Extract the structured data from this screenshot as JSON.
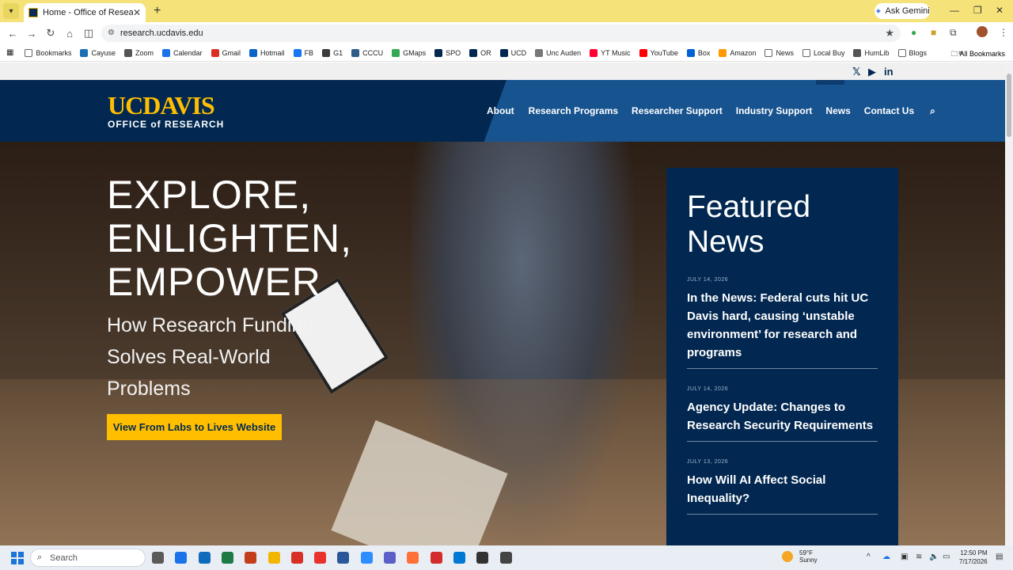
{
  "browser": {
    "tab_title": "Home - Office of Research",
    "new_tab": "+",
    "ask_gemini": "Ask Gemini",
    "url": "research.ucdavis.edu",
    "all_bookmarks": "All Bookmarks",
    "bookmarks": [
      {
        "label": "Bookmarks",
        "color": "#ffffff"
      },
      {
        "label": "Cayuse",
        "color": "#1a6fb5"
      },
      {
        "label": "Zoom",
        "color": "#555555"
      },
      {
        "label": "Calendar",
        "color": "#1a73e8"
      },
      {
        "label": "Gmail",
        "color": "#d93025"
      },
      {
        "label": "Hotmail",
        "color": "#0a64c8"
      },
      {
        "label": "FB",
        "color": "#1877f2"
      },
      {
        "label": "G1",
        "color": "#3c3c3c"
      },
      {
        "label": "CCCU",
        "color": "#2f5d8a"
      },
      {
        "label": "GMaps",
        "color": "#34a853"
      },
      {
        "label": "SPO",
        "color": "#022851"
      },
      {
        "label": "OR",
        "color": "#022851"
      },
      {
        "label": "UCD",
        "color": "#022851"
      },
      {
        "label": "Unc Auden",
        "color": "#777777"
      },
      {
        "label": "YT Music",
        "color": "#ff0033"
      },
      {
        "label": "YouTube",
        "color": "#ff0000"
      },
      {
        "label": "Box",
        "color": "#0061d5"
      },
      {
        "label": "Amazon",
        "color": "#ff9900"
      },
      {
        "label": "News",
        "color": "#ffffff"
      },
      {
        "label": "Local Buy",
        "color": "#ffffff"
      },
      {
        "label": "HumLib",
        "color": "#555555"
      },
      {
        "label": "Blogs",
        "color": "#ffffff"
      }
    ]
  },
  "site": {
    "logo_uc": "UC",
    "logo_davis": "DAVIS",
    "logo_office": "OFFICE of RESEARCH",
    "social": [
      "𝕏",
      "▶",
      "in"
    ],
    "nav": [
      "About",
      "Research Programs",
      "Researcher Support",
      "Industry Support",
      "News",
      "Contact Us"
    ],
    "hero": {
      "title_lines": [
        "EXPLORE,",
        "ENLIGHTEN,",
        "EMPOWER"
      ],
      "subtitle_lines": [
        "How Research Funding",
        "Solves Real-World",
        "Problems"
      ],
      "button": "View From Labs to Lives Website"
    },
    "featured": {
      "title": "Featured News",
      "items": [
        {
          "date": "JULY 14, 2026",
          "headline": "In the News: Federal cuts hit UC Davis hard, causing ‘unstable environment’ for research and programs"
        },
        {
          "date": "JULY 14, 2026",
          "headline": "Agency Update: Changes to Research Security Requirements"
        },
        {
          "date": "JULY 13, 2026",
          "headline": "How Will AI Affect Social Inequality?"
        }
      ]
    }
  },
  "taskbar": {
    "search_placeholder": "Search",
    "weather_temp": "59°F",
    "weather_desc": "Sunny",
    "time": "12:50 PM",
    "date": "7/17/2026",
    "app_colors": [
      "#5a5a5a",
      "#1a73e8",
      "#0f6cbd",
      "#1d7a45",
      "#c43e1c",
      "#f2b600",
      "#d93025",
      "#e8322b",
      "#2b579a",
      "#2d8cff",
      "#5b5fc7",
      "#ff7139",
      "#d42c2c",
      "#0078d4",
      "#333333",
      "#444444"
    ]
  }
}
